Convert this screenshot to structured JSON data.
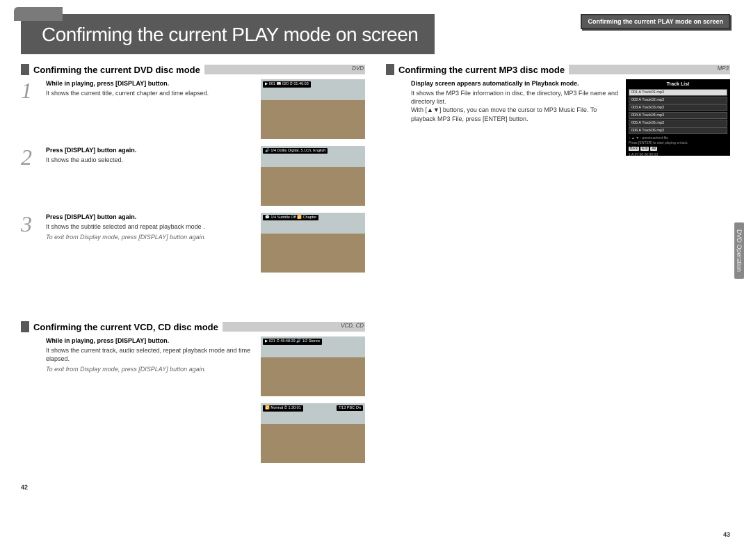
{
  "page_title": "Confirming the current PLAY mode on screen",
  "mini_tab": "Confirming the current PLAY mode on screen",
  "side_tab": "DVD Operation",
  "pages": {
    "left": "42",
    "right": "43"
  },
  "dvd": {
    "heading": "Confirming the current DVD disc mode",
    "tag": "DVD",
    "steps": [
      {
        "bold": "While in playing, press [DISPLAY] button.",
        "body": "It shows the current title, current chapter and time elapsed.",
        "osd": "▶ 001   📖 020   ⏱ 01:46:03"
      },
      {
        "bold": "Press [DISPLAY] button again.",
        "body": "It shows the audio selected.",
        "osd": "🔊 1/4 Dolby Digital, 5.1Ch, English"
      },
      {
        "bold": "Press [DISPLAY] button again.",
        "body": "It shows the subtitle selected and repeat playback mode .",
        "note": "To exit from Display mode, press [DISPLAY] button again.",
        "osd": "💬 1/4 Subtitle Off   🔁 Chapter"
      }
    ]
  },
  "vcd": {
    "heading": "Confirming the current VCD, CD disc mode",
    "tag": "VCD, CD",
    "step": {
      "bold": "While in playing, press [DISPLAY] button.",
      "body": "It shows the current track, audio selected, repeat playback mode and time elapsed.",
      "note": "To exit from Display mode, press [DISPLAY] button again."
    },
    "osd1": "▶ 021   ⏱ 45:48:29   🔊 1/2 Stereo",
    "osd2_left": "🔁 Normal   ⏱ 1:30:01",
    "osd2_right": "7/13 PBC On"
  },
  "mp3": {
    "heading": "Confirming the current MP3 disc mode",
    "tag": "MP3",
    "step": {
      "bold": "Display screen appears automatically in Playback mode.",
      "body": "It shows the MP3 File information in disc, the directory, MP3 File name and directory list.",
      "body2": "With [▲▼] buttons, you can move the cursor to MP3 Music File. To playback MP3 File, press [ENTER] button."
    },
    "tracklist": {
      "title": "Track List",
      "items": [
        "001 A Track01.mp3",
        "002 A Track02.mp3",
        "003 A Track03.mp3",
        "004 A Track04.mp3",
        "005 A Track05.mp3",
        "006 A Track06.mp3"
      ],
      "hint1": "↕ ▲ ▼ : previous/next file",
      "hint2": "Press [ENTER] to start playing a track.",
      "buttons": [
        "Back",
        "Exit",
        "All"
      ],
      "footer": "1 A.07:06   00:00:03"
    }
  }
}
